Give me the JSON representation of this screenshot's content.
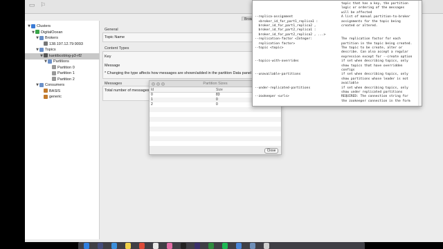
{
  "tree": {
    "items": [
      {
        "label": "Clusters",
        "indent": 0,
        "arrow": "▼",
        "icon_color": "#3a7bd5",
        "selected": false
      },
      {
        "label": "DigitalOcean",
        "indent": 1,
        "arrow": "▼",
        "icon_color": "#3aa54a",
        "selected": false
      },
      {
        "label": "Brokers",
        "indent": 2,
        "arrow": "▼",
        "icon_color": "#6b90c8",
        "selected": false
      },
      {
        "label": "138.197.12.79:9093",
        "indent": 3,
        "arrow": "",
        "icon_color": "#777777",
        "selected": false
      },
      {
        "label": "Topics",
        "indent": 2,
        "arrow": "▼",
        "icon_color": "#6b90c8",
        "selected": false
      },
      {
        "label": "kantibcoblog-p3-rf2",
        "indent": 3,
        "arrow": "▼",
        "icon_color": "#555555",
        "selected": true
      },
      {
        "label": "Partitions",
        "indent": 4,
        "arrow": "▼",
        "icon_color": "#6b90c8",
        "selected": false
      },
      {
        "label": "Partition 0",
        "indent": 5,
        "arrow": "",
        "icon_color": "#999999",
        "selected": false
      },
      {
        "label": "Partition 1",
        "indent": 5,
        "arrow": "",
        "icon_color": "#999999",
        "selected": false
      },
      {
        "label": "Partition 2",
        "indent": 5,
        "arrow": "",
        "icon_color": "#999999",
        "selected": false
      },
      {
        "label": "Consumers",
        "indent": 2,
        "arrow": "▼",
        "icon_color": "#6b90c8",
        "selected": false
      },
      {
        "label": "BASIS",
        "indent": 3,
        "arrow": "",
        "icon_color": "#c27a2c",
        "selected": false
      },
      {
        "label": "generic",
        "indent": 3,
        "arrow": "",
        "icon_color": "#c27a2c",
        "selected": false
      }
    ]
  },
  "details": {
    "general_title": "General",
    "topic_name_label": "Topic Name",
    "content_types_title": "Content Types",
    "key_label": "Key",
    "message_label": "Message",
    "note": "* Changing the type affects how messages are shown/added in the partition Data panel",
    "messages_title": "Messages",
    "total_label": "Total number of messages",
    "tab_label": "Brow"
  },
  "dialog": {
    "title": "Partition Sizes",
    "col_id": "Id",
    "col_size": "Size",
    "rows": [
      {
        "id": "0",
        "size": "83"
      },
      {
        "id": "1",
        "size": "0"
      },
      {
        "id": "2",
        "size": "0"
      }
    ],
    "close_label": "Close"
  },
  "terminal": {
    "lines": [
      {
        "left": "",
        "right": "topic that has a key, the partition"
      },
      {
        "left": "",
        "right": "logic or ordering of the messages"
      },
      {
        "left": "",
        "right": "will be affected"
      },
      {
        "left": "--replica-assignment",
        "right": "A list of manual partition-to-broker"
      },
      {
        "left": "  <broker_id_for_part1_replica1 :",
        "right": "assignments for the topic being"
      },
      {
        "left": "  broker_id_for_part1_replica2 ,",
        "right": "created or altered."
      },
      {
        "left": "  broker_id_for_part2_replica1 :",
        "right": ""
      },
      {
        "left": "  broker_id_for_part2_replica2 , ...>",
        "right": ""
      },
      {
        "left": "--replication-factor <Integer:",
        "right": "The replication factor for each"
      },
      {
        "left": "  replication factor>",
        "right": "partition in the topic being created."
      },
      {
        "left": "--topic <topic>",
        "right": "The topic to be create, alter or"
      },
      {
        "left": "",
        "right": "describe. Can also accept a regular"
      },
      {
        "left": "",
        "right": "expression except for --create option"
      },
      {
        "left": "--topics-with-overrides",
        "right": "if set when describing topics, only"
      },
      {
        "left": "",
        "right": "show topics that have overridden"
      },
      {
        "left": "",
        "right": "configs"
      },
      {
        "left": "--unavailable-partitions",
        "right": "if set when describing topics, only"
      },
      {
        "left": "",
        "right": "show partitions whose leader is not"
      },
      {
        "left": "",
        "right": "available"
      },
      {
        "left": "--under-replicated-partitions",
        "right": "if set when describing topics, only"
      },
      {
        "left": "",
        "right": "show under replicated partitions"
      },
      {
        "left": "--zookeeper <urls>",
        "right": "REQUIRED: The connection string for"
      },
      {
        "left": "",
        "right": "the zookeeper connection in the form"
      }
    ]
  },
  "dock": {
    "icons": [
      {
        "name": "finder-icon",
        "color": "#2f7fe0"
      },
      {
        "name": "launchpad-icon",
        "color": "#444c7a"
      },
      {
        "name": "safari-icon",
        "color": "#3b8fdc"
      },
      {
        "name": "notes-icon",
        "color": "#f2d14a"
      },
      {
        "name": "chrome-icon",
        "color": "#dd4b39"
      },
      {
        "name": "photos-icon",
        "color": "#e8e8e8"
      },
      {
        "name": "itunes-icon",
        "color": "#e26da5"
      },
      {
        "name": "terminal-icon",
        "color": "#222222"
      },
      {
        "name": "eclipse-icon",
        "color": "#3a2f6b"
      },
      {
        "name": "excel-icon",
        "color": "#2e8b3e"
      },
      {
        "name": "spotify-icon",
        "color": "#1db954"
      },
      {
        "name": "xcode-icon",
        "color": "#4a86d8"
      },
      {
        "name": "downloads-icon",
        "color": "#6f8fb8"
      },
      {
        "name": "trash-icon",
        "color": "#cfcfcf"
      }
    ]
  }
}
